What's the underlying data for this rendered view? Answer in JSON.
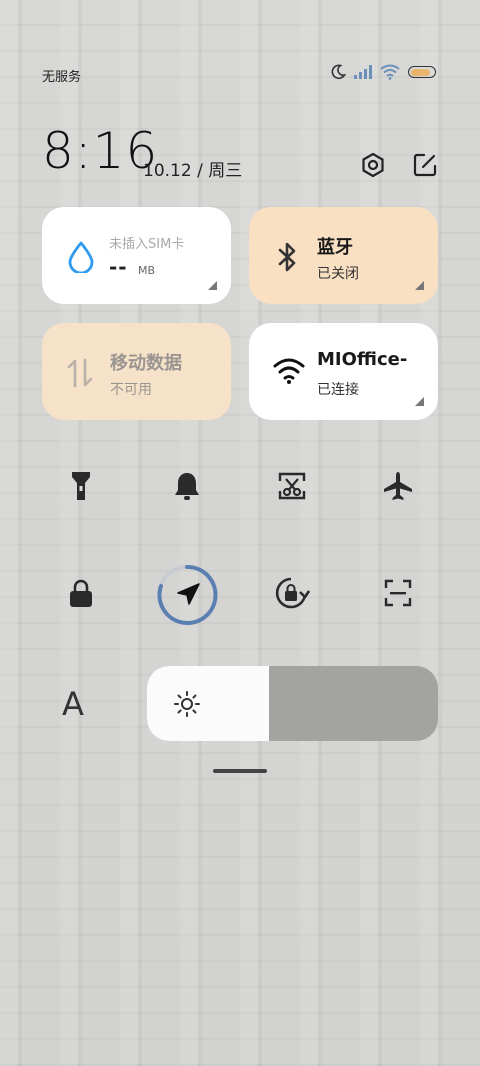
{
  "status_bar": {
    "carrier": "无服务",
    "icons": [
      "moon-icon",
      "signal-icon",
      "wifi-icon",
      "battery-icon"
    ],
    "battery_level": 0.85
  },
  "header": {
    "time": "8:16",
    "date": "10.12 / 周三",
    "actions": [
      "settings-icon",
      "edit-icon"
    ]
  },
  "tiles": {
    "data": {
      "caption": "未插入SIM卡",
      "value": "--",
      "unit": "MB",
      "icon": "water-drop-icon"
    },
    "bluetooth": {
      "title": "蓝牙",
      "status": "已关闭",
      "icon": "bluetooth-icon"
    },
    "mobile_data": {
      "title": "移动数据",
      "status": "不可用",
      "icon": "data-arrows-icon"
    },
    "wifi": {
      "title": "MIOffice-",
      "status": "已连接",
      "icon": "wifi-icon"
    }
  },
  "toggles_row1": [
    "flashlight-icon",
    "bell-icon",
    "screenshot-icon",
    "airplane-icon"
  ],
  "toggles_row2": [
    "lock-icon",
    "location-icon",
    "rotation-lock-icon",
    "scan-icon"
  ],
  "brightness": {
    "level": 0.42,
    "auto_icon": "font-size-icon",
    "sun_icon": "sun-icon"
  },
  "colors": {
    "tile_active": "#f9e0c3",
    "tile_white": "#ffffff",
    "accent_blue": "#2e9bf0",
    "location_ring": "#5a7fb0"
  }
}
